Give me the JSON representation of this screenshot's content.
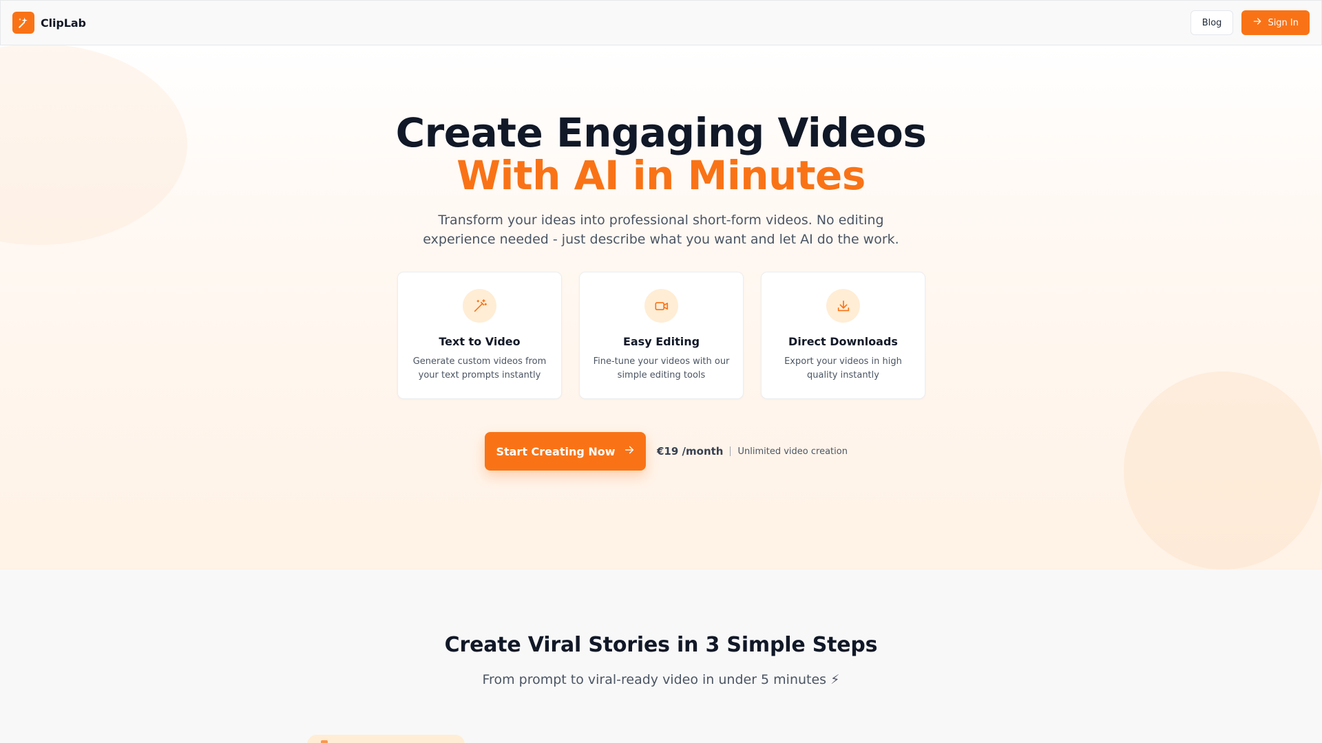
{
  "header": {
    "brand_name": "ClipLab",
    "blog_label": "Blog",
    "signin_label": "Sign In"
  },
  "hero": {
    "title_line1": "Create Engaging Videos",
    "title_line2": "With AI in Minutes",
    "subtitle": "Transform your ideas into professional short-form videos. No editing experience needed - just describe what you want and let AI do the work.",
    "features": [
      {
        "icon": "magic-wand-icon",
        "title": "Text to Video",
        "description": "Generate custom videos from your text prompts instantly"
      },
      {
        "icon": "video-camera-icon",
        "title": "Easy Editing",
        "description": "Fine-tune your videos with our simple editing tools"
      },
      {
        "icon": "download-icon",
        "title": "Direct Downloads",
        "description": "Export your videos in high quality instantly"
      }
    ],
    "cta_label": "Start Creating Now",
    "price": "€19 /month",
    "price_note": "Unlimited video creation"
  },
  "steps": {
    "title": "Create Viral Stories in 3 Simple Steps",
    "subtitle": "From prompt to viral-ready video in under 5 minutes ⚡"
  },
  "colors": {
    "accent": "#f97316",
    "accent_soft": "#ffedd5",
    "text_dark": "#111827",
    "text_muted": "#4b5563"
  }
}
